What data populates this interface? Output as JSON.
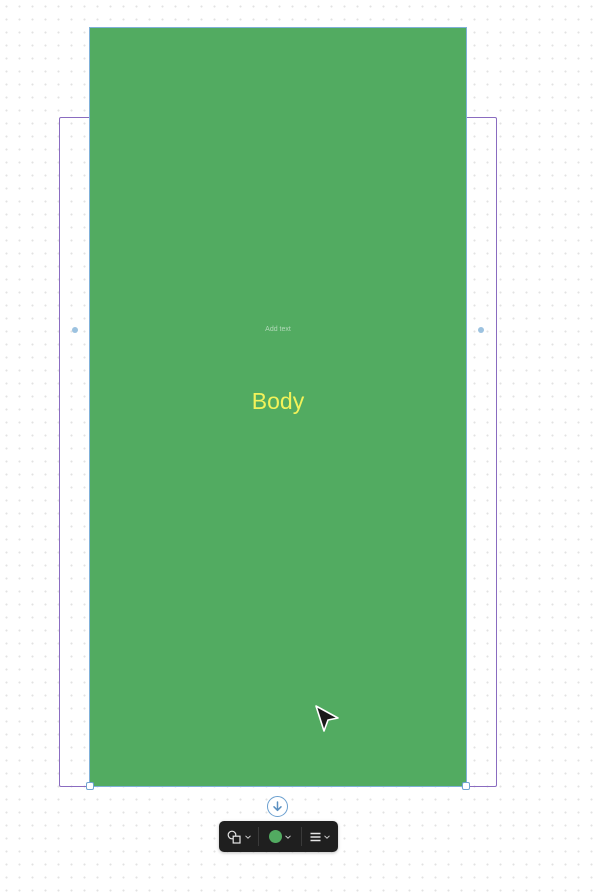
{
  "canvas": {
    "shape": {
      "placeholder": "Add text",
      "label": "Body",
      "fill_color": "#52ab61",
      "text_color": "#f2f25a"
    },
    "frame": {
      "stroke_color": "#8a6cc0"
    }
  },
  "toolbar": {
    "items": [
      {
        "name": "shape-type",
        "icon": "shapes-icon"
      },
      {
        "name": "fill-color",
        "icon": "color-swatch",
        "value": "#52ab61"
      },
      {
        "name": "text-align",
        "icon": "align-lines-icon"
      }
    ]
  },
  "icons": {
    "connector": "arrow-down-circle-icon",
    "cursor": "arrow-pointer-icon"
  }
}
